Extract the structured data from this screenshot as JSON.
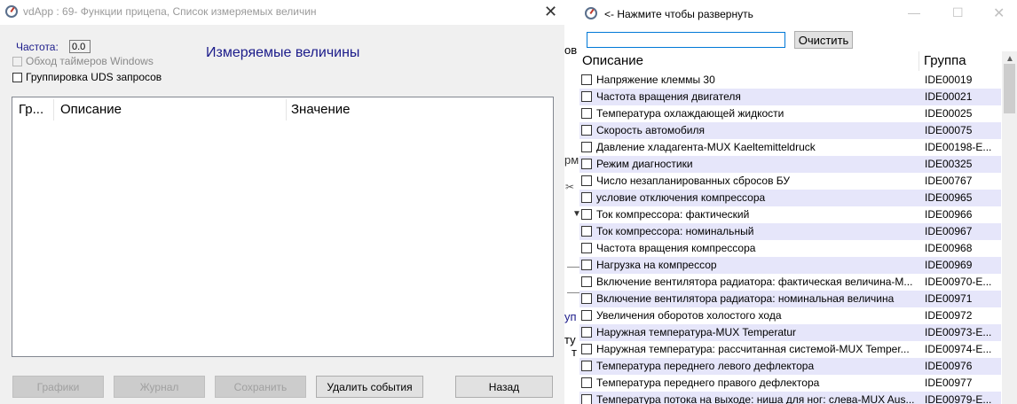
{
  "left_window": {
    "title": "vdApp : 69- Функции прицепа,  Список измеряемых величин",
    "close_glyph": "✕",
    "frequency_label": "Частота:",
    "frequency_value": "0.0",
    "bypass_timers_label": "Обход таймеров Windows",
    "group_uds_label": "Группировка UDS запросов",
    "heading": "Измеряемые величины",
    "columns": {
      "group": "Гр...",
      "description": "Описание",
      "value": "Значение"
    },
    "buttons": {
      "graphs": "Графики",
      "journal": "Журнал",
      "save": "Сохранить",
      "delete_events": "Удалить события",
      "back": "Назад"
    }
  },
  "background_fragments": [
    "ов",
    "рм",
    "уп",
    "ту",
    "т"
  ],
  "right_window": {
    "title": "<- Нажмите чтобы развернуть",
    "search_value": "",
    "clear_button": "Очистить",
    "columns": {
      "description": "Описание",
      "group": "Группа"
    },
    "rows": [
      {
        "description": "Напряжение клеммы 30",
        "group": "IDE00019"
      },
      {
        "description": "Частота вращения двигателя",
        "group": "IDE00021"
      },
      {
        "description": "Температура охлаждающей жидкости",
        "group": "IDE00025"
      },
      {
        "description": "Скорость автомобиля",
        "group": "IDE00075"
      },
      {
        "description": "Давление хладагента-MUX Kaeltemitteldruck",
        "group": "IDE00198-E..."
      },
      {
        "description": "Режим диагностики",
        "group": "IDE00325"
      },
      {
        "description": "Число незапланированных сбросов БУ",
        "group": "IDE00767"
      },
      {
        "description": "условие отключения компрессора",
        "group": "IDE00965"
      },
      {
        "description": "Ток компрессора: фактический",
        "group": "IDE00966"
      },
      {
        "description": "Ток компрессора: номинальный",
        "group": "IDE00967"
      },
      {
        "description": "Частота вращения компрессора",
        "group": "IDE00968"
      },
      {
        "description": "Нагрузка на компрессор",
        "group": "IDE00969"
      },
      {
        "description": "Включение вентилятора радиатора: фактическая величина-M...",
        "group": "IDE00970-E..."
      },
      {
        "description": "Включение вентилятора радиатора: номинальная величина",
        "group": "IDE00971"
      },
      {
        "description": "Увеличения оборотов холостого хода",
        "group": "IDE00972"
      },
      {
        "description": "Наружная температура-MUX Temperatur",
        "group": "IDE00973-E..."
      },
      {
        "description": "Наружная температура: рассчитанная системой-MUX Temper...",
        "group": "IDE00974-E..."
      },
      {
        "description": "Температура переднего левого дефлектора",
        "group": "IDE00976"
      },
      {
        "description": "Температура переднего правого дефлектора",
        "group": "IDE00977"
      },
      {
        "description": "Температура потока на выходе: ниша для ног: слева-MUX Aus...",
        "group": "IDE00979-E..."
      }
    ]
  }
}
